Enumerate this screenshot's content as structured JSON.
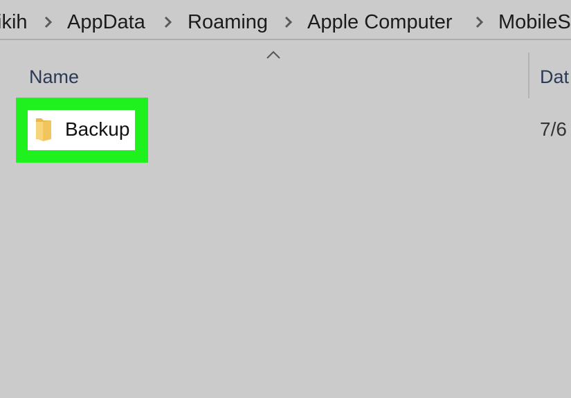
{
  "breadcrumb": {
    "items": [
      "ikih",
      "AppData",
      "Roaming",
      "Apple Computer",
      "MobileS"
    ]
  },
  "columns": {
    "name_label": "Name",
    "date_label": "Dat"
  },
  "files": [
    {
      "name": "Backup",
      "date": "7/6",
      "icon": "folder-icon",
      "highlighted": true
    }
  ],
  "colors": {
    "background": "#cbcbcb",
    "highlight": "#1ef11e",
    "folder": "#e8b84a",
    "header_text": "#2b3a55"
  }
}
